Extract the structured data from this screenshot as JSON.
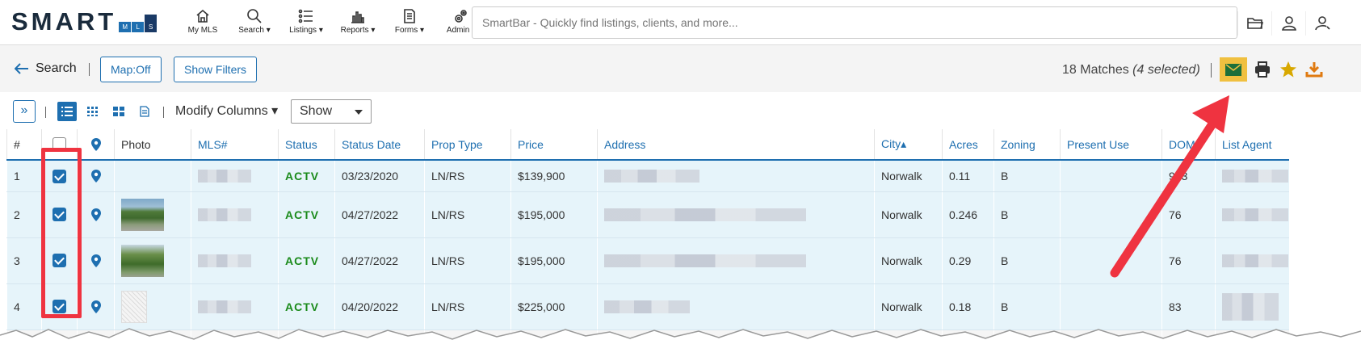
{
  "logo": {
    "text": "SMART",
    "mls": [
      "M",
      "L",
      "S"
    ]
  },
  "nav": [
    {
      "label": "My MLS",
      "icon": "home-icon"
    },
    {
      "label": "Search ▾",
      "icon": "search-icon"
    },
    {
      "label": "Listings ▾",
      "icon": "list-icon"
    },
    {
      "label": "Reports ▾",
      "icon": "bar-chart-icon"
    },
    {
      "label": "Forms ▾",
      "icon": "document-icon"
    },
    {
      "label": "Admin ▾",
      "icon": "gears-icon"
    }
  ],
  "smartbar": {
    "placeholder": "SmartBar - Quickly find listings, clients, and more..."
  },
  "toolbar": {
    "back_label": "Search",
    "map_button": "Map:Off",
    "filters_button": "Show Filters",
    "matches": "18 Matches",
    "selected": "(4 selected)"
  },
  "toolbar2": {
    "expand": "»",
    "modify_columns": "Modify Columns ▾",
    "show_label": "Show"
  },
  "table": {
    "headers": {
      "num": "#",
      "photo": "Photo",
      "mls": "MLS#",
      "status": "Status",
      "status_date": "Status Date",
      "prop_type": "Prop Type",
      "price": "Price",
      "address": "Address",
      "city": "City▴",
      "acres": "Acres",
      "zoning": "Zoning",
      "present_use": "Present Use",
      "dom": "DOM",
      "list_agent": "List Agent"
    },
    "rows": [
      {
        "num": "1",
        "status": "ACTV",
        "status_date": "03/23/2020",
        "prop_type": "LN/RS",
        "price": "$139,900",
        "city": "Norwalk",
        "acres": "0.11",
        "zoning": "B",
        "present_use": "",
        "dom": "993"
      },
      {
        "num": "2",
        "status": "ACTV",
        "status_date": "04/27/2022",
        "prop_type": "LN/RS",
        "price": "$195,000",
        "city": "Norwalk",
        "acres": "0.246",
        "zoning": "B",
        "present_use": "",
        "dom": "76"
      },
      {
        "num": "3",
        "status": "ACTV",
        "status_date": "04/27/2022",
        "prop_type": "LN/RS",
        "price": "$195,000",
        "city": "Norwalk",
        "acres": "0.29",
        "zoning": "B",
        "present_use": "",
        "dom": "76"
      },
      {
        "num": "4",
        "status": "ACTV",
        "status_date": "04/20/2022",
        "prop_type": "LN/RS",
        "price": "$225,000",
        "city": "Norwalk",
        "acres": "0.18",
        "zoning": "B",
        "present_use": "",
        "dom": "83"
      }
    ]
  },
  "colors": {
    "accent": "#1e6fb0",
    "status_active": "#1a8a1a",
    "highlight_email": "#f0c040",
    "annotation_red": "#ef3340",
    "star": "#d8a800",
    "download": "#e07a10"
  }
}
